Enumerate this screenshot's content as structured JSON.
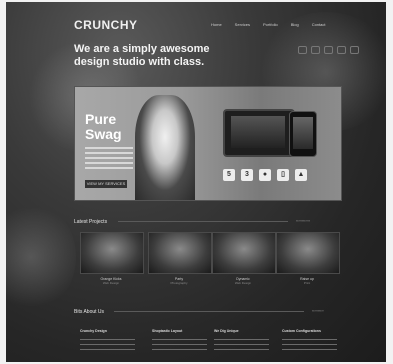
{
  "header": {
    "logo": "CRUNCHY",
    "nav": [
      "Home",
      "Services",
      "Portfolio",
      "Blog",
      "Contact"
    ]
  },
  "hero": {
    "title_line1": "We are a simply awesome",
    "title_line2": "design studio with class."
  },
  "banner": {
    "title_line1": "Pure",
    "title_line2": "Swag",
    "button": "VIEW MY SERVICES",
    "platform_icons": [
      "html5-icon",
      "css3-icon",
      "apple-icon",
      "device-icon",
      "android-icon"
    ]
  },
  "latest_projects": {
    "heading": "Latest Projects",
    "items": [
      {
        "title": "Orange Kicks",
        "sub": "Web Design"
      },
      {
        "title": "Party",
        "sub": "Photography"
      },
      {
        "title": "Dynamic",
        "sub": "Web Design"
      },
      {
        "title": "Raise up",
        "sub": "Print"
      }
    ]
  },
  "about": {
    "heading": "Bits About Us",
    "columns": [
      "Crunchy Design",
      "Shoptastic Layout",
      "We Dig Unique",
      "Custom Configurations"
    ]
  }
}
